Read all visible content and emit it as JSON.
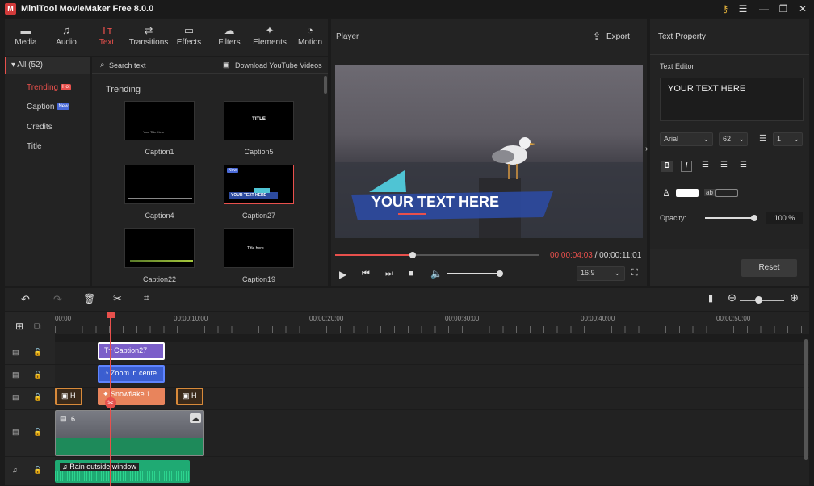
{
  "app": {
    "title": "MiniTool MovieMaker Free 8.0.0",
    "logo": "M"
  },
  "window_controls": {
    "key_icon": "⚷",
    "menu_icon": "☰",
    "minimize_icon": "—",
    "restore_icon": "❐",
    "close_icon": "✕"
  },
  "toolbar": {
    "items": [
      {
        "label": "Media",
        "icon": "folder-icon",
        "glyph": "▬"
      },
      {
        "label": "Audio",
        "icon": "music-icon",
        "glyph": "♫"
      },
      {
        "label": "Text",
        "icon": "text-icon",
        "glyph": "Tт"
      },
      {
        "label": "Transitions",
        "icon": "transitions-icon",
        "glyph": "⇄"
      },
      {
        "label": "Effects",
        "icon": "effects-icon",
        "glyph": "▭"
      },
      {
        "label": "Filters",
        "icon": "filters-icon",
        "glyph": "☁"
      },
      {
        "label": "Elements",
        "icon": "elements-icon",
        "glyph": "✦"
      },
      {
        "label": "Motion",
        "icon": "motion-icon",
        "glyph": "◔"
      }
    ],
    "active": "Text"
  },
  "categories": {
    "all_label": "All (52)",
    "items": [
      {
        "label": "Trending",
        "badge": "Hot",
        "badge_color": "#e8504c"
      },
      {
        "label": "Caption",
        "badge": "New",
        "badge_color": "#4a6ad8"
      },
      {
        "label": "Credits",
        "badge": ""
      },
      {
        "label": "Title",
        "badge": ""
      }
    ]
  },
  "library": {
    "search_label": "Search text",
    "download_label": "Download YouTube Videos",
    "section_title": "Trending",
    "thumbs": [
      {
        "label": "Caption1",
        "inner": "Your Title Here"
      },
      {
        "label": "Caption5",
        "inner": "TITLE"
      },
      {
        "label": "Caption4",
        "inner": ""
      },
      {
        "label": "Caption27",
        "inner": "YOUR TEXT HERE",
        "badge": "New"
      },
      {
        "label": "Caption22",
        "inner": ""
      },
      {
        "label": "Caption19",
        "inner": "Title here"
      }
    ]
  },
  "player": {
    "title": "Player",
    "export_label": "Export",
    "overlay_text": "YOUR TEXT HERE",
    "current_time": "00:00:04:03",
    "separator": " / ",
    "total_time": "00:00:11:01",
    "aspect_ratio": "16:9",
    "progress": 0.38,
    "volume": 1.0
  },
  "text_property": {
    "title": "Text Property",
    "editor_label": "Text Editor",
    "editor_value": "YOUR TEXT HERE",
    "font": "Arial",
    "font_size": "62",
    "line_spacing": "1",
    "opacity_label": "Opacity:",
    "opacity_value": "100 %",
    "bold": "B",
    "italic": "I",
    "abc": "ab",
    "color_label": "A",
    "reset_label": "Reset"
  },
  "timeline": {
    "ruler_labels": [
      "00:00",
      "00:00:10:00",
      "00:00:20:00",
      "00:00:30:00",
      "00:00:40:00",
      "00:00:50:00"
    ],
    "text_clip": "Caption27",
    "motion_clip": "Zoom in cente",
    "element_clip": "Snowflake 1",
    "element_left": "H",
    "element_right": "H",
    "video_clip_count": "6",
    "audio_clip": "Rain outside window"
  },
  "colors": {
    "accent": "#e8504c",
    "text_clip": "#7b5fc9",
    "motion_clip": "#3b5ed0",
    "element_clip": "#e8845c",
    "video_clip": "#1e8a5a",
    "audio_clip": "#1faa73"
  }
}
